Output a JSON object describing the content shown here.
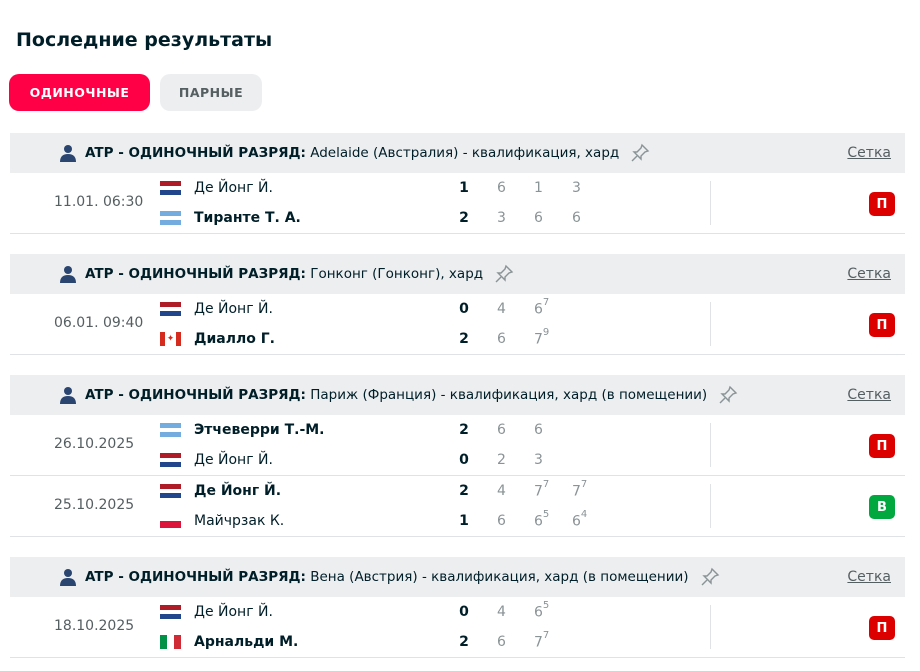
{
  "page_title": "Последние результаты",
  "tabs": [
    {
      "label": "ОДИНОЧНЫЕ",
      "active": true
    },
    {
      "label": "ПАРНЫЕ",
      "active": false
    }
  ],
  "colors": {
    "accent": "#ff0046",
    "loss": "#dc0000",
    "win": "#00a83f"
  },
  "tournaments": [
    {
      "category": "ATP - ОДИНОЧНЫЙ РАЗРЯД:",
      "name": "Adelaide (Австралия) - квалификация, хард",
      "link": "Сетка",
      "matches": [
        {
          "date": "11.01. 06:30",
          "result": "П",
          "players": [
            {
              "name": "Де Йонг Й.",
              "flag": "netherlands",
              "total": "1",
              "sets": [
                [
                  "6",
                  ""
                ],
                [
                  "1",
                  ""
                ],
                [
                  "3",
                  ""
                ]
              ],
              "winner": false
            },
            {
              "name": "Тиранте Т. А.",
              "flag": "argentina",
              "total": "2",
              "sets": [
                [
                  "3",
                  ""
                ],
                [
                  "6",
                  ""
                ],
                [
                  "6",
                  ""
                ]
              ],
              "winner": true
            }
          ]
        }
      ]
    },
    {
      "category": "ATP - ОДИНОЧНЫЙ РАЗРЯД:",
      "name": "Гонконг (Гонконг), хард",
      "link": "Сетка",
      "matches": [
        {
          "date": "06.01. 09:40",
          "result": "П",
          "players": [
            {
              "name": "Де Йонг Й.",
              "flag": "netherlands",
              "total": "0",
              "sets": [
                [
                  "4",
                  ""
                ],
                [
                  "6",
                  "7"
                ]
              ],
              "winner": false
            },
            {
              "name": "Диалло Г.",
              "flag": "canada",
              "total": "2",
              "sets": [
                [
                  "6",
                  ""
                ],
                [
                  "7",
                  "9"
                ]
              ],
              "winner": true
            }
          ]
        }
      ]
    },
    {
      "category": "ATP - ОДИНОЧНЫЙ РАЗРЯД:",
      "name": "Париж (Франция) - квалификация, хард (в помещении)",
      "link": "Сетка",
      "matches": [
        {
          "date": "26.10.2025",
          "result": "П",
          "players": [
            {
              "name": "Этчеверри Т.-М.",
              "flag": "argentina",
              "total": "2",
              "sets": [
                [
                  "6",
                  ""
                ],
                [
                  "6",
                  ""
                ]
              ],
              "winner": true
            },
            {
              "name": "Де Йонг Й.",
              "flag": "netherlands",
              "total": "0",
              "sets": [
                [
                  "2",
                  ""
                ],
                [
                  "3",
                  ""
                ]
              ],
              "winner": false
            }
          ]
        },
        {
          "date": "25.10.2025",
          "result": "В",
          "players": [
            {
              "name": "Де Йонг Й.",
              "flag": "netherlands",
              "total": "2",
              "sets": [
                [
                  "4",
                  ""
                ],
                [
                  "7",
                  "7"
                ],
                [
                  "7",
                  "7"
                ]
              ],
              "winner": true
            },
            {
              "name": "Майчрзак К.",
              "flag": "poland",
              "total": "1",
              "sets": [
                [
                  "6",
                  ""
                ],
                [
                  "6",
                  "5"
                ],
                [
                  "6",
                  "4"
                ]
              ],
              "winner": false
            }
          ]
        }
      ]
    },
    {
      "category": "ATP - ОДИНОЧНЫЙ РАЗРЯД:",
      "name": "Вена (Австрия) - квалификация, хард (в помещении)",
      "link": "Сетка",
      "matches": [
        {
          "date": "18.10.2025",
          "result": "П",
          "players": [
            {
              "name": "Де Йонг Й.",
              "flag": "netherlands",
              "total": "0",
              "sets": [
                [
                  "4",
                  ""
                ],
                [
                  "6",
                  "5"
                ]
              ],
              "winner": false
            },
            {
              "name": "Арнальди М.",
              "flag": "italy",
              "total": "2",
              "sets": [
                [
                  "6",
                  ""
                ],
                [
                  "7",
                  "7"
                ]
              ],
              "winner": true
            }
          ]
        }
      ]
    }
  ]
}
